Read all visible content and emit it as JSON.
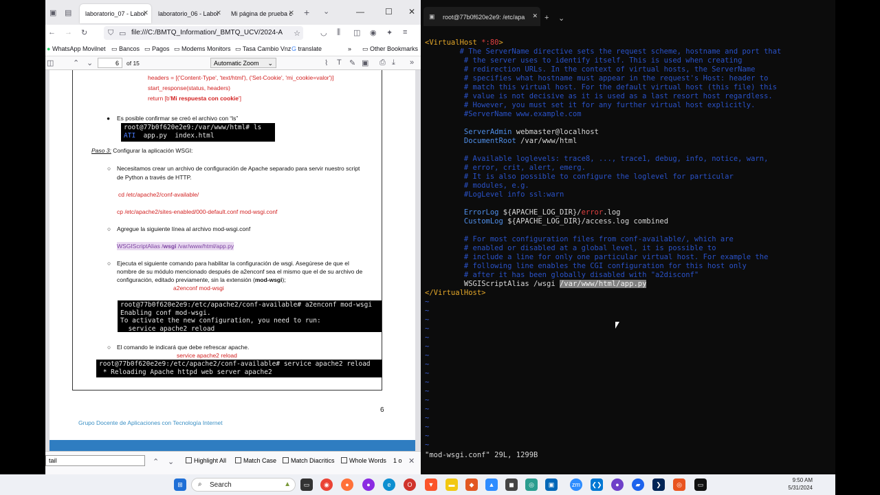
{
  "firefox": {
    "tabs": [
      "laboratorio_07 - Labor",
      "laboratorio_06 - Labor",
      "Mi página de prueba c"
    ],
    "url": "file:///C:/BMTQ_Information/_BMTQ_UCV/2024-A",
    "bookmarks": [
      "WhatsApp Movilnet",
      "Bancos",
      "Pagos",
      "Modems Monitors",
      "Tasa Cambio Vnz",
      "translate",
      "Other Bookmarks"
    ],
    "page_number": "6",
    "page_total": "of 15",
    "zoom": "Automatic Zoom",
    "find": {
      "query": "tail",
      "options": [
        "Highlight All",
        "Match Case",
        "Match Diacritics",
        "Whole Words"
      ],
      "count": "1 o"
    }
  },
  "pdf": {
    "code1": "headers = [('Content-Type', 'text/html'), ('Set-Cookie', 'mi_cookie=valor')]",
    "code2": "start_response(status, headers)",
    "code3_pre": "return [b'",
    "code3_bold": "Mi respuesta con cookie",
    "code3_post": "']",
    "bullet1": "Es posible confirmar se creó el archivo con “ls”",
    "term1_l1": "root@77b0f620e2e9:/var/www/html# ls",
    "term1_l2_a": "ATI",
    "term1_l2_b": "  app.py  index.html",
    "paso_label": "Paso 3:",
    "paso_text": "Configurar la aplicación WSGI:",
    "b2a": "Necesitamos crear un archivo de configuración de Apache separado para servir nuestro script",
    "b2b": "de Python a través de HTTP.",
    "cmd1": "cd /etc/apache2/conf-available/",
    "cmd2": "cp /etc/apache2/sites-enabled/000-default.conf mod-wsgi.conf",
    "b3": "Agregue la siguiente línea al archivo mod-wsgi.conf",
    "wsgi_a": "WSGIScriptAlias /",
    "wsgi_b": "wsgi",
    "wsgi_c": " /var/www/html/app.py",
    "b4a": "Ejecuta el siguiente comando para habilitar la configuración de wsgi. Asegúrese de que el",
    "b4b": "nombre de su módulo mencionado después de a2enconf sea el mismo que el de su archivo de",
    "b4c_pre": "configuración, editado previamente, sin la extensión (",
    "b4c_bold": "mod-wsgi",
    "b4c_post": ");",
    "cmd3": "a2enconf mod-wsgi",
    "term2": "root@77b0f620e2e9:/etc/apache2/conf-available# a2enconf mod-wsgi\nEnabling conf mod-wsgi.\nTo activate the new configuration, you need to run:\n  service apache2 reload",
    "b5": "El comando le indicará que debe refrescar apache.",
    "cmd4": "service apache2 reload",
    "term3": "root@77b0f620e2e9:/etc/apache2/conf-available# service apache2 reload\n * Reloading Apache httpd web server apache2",
    "page_num": "6",
    "footer": "Grupo Docente de Aplicaciones con Tecnología Internet"
  },
  "terminal": {
    "tab_title": "root@77b0f620e2e9: /etc/apa",
    "vh_open_a": "<VirtualHost",
    "vh_open_b": " *:80",
    "vh_open_c": ">",
    "c1": [
      "        # The ServerName directive sets the request scheme, hostname and port that",
      "         # the server uses to identify itself. This is used when creating",
      "         # redirection URLs. In the context of virtual hosts, the ServerName",
      "         # specifies what hostname must appear in the request's Host: header to",
      "         # match this virtual host. For the default virtual host (this file) this",
      "         # value is not decisive as it is used as a last resort host regardless.",
      "         # However, you must set it for any further virtual host explicitly.",
      "         #ServerName www.example.com"
    ],
    "sa_key": "ServerAdmin",
    "sa_val": " webmaster@localhost",
    "dr_key": "DocumentRoot",
    "dr_val": " /var/www/html",
    "c2": [
      "         # Available loglevels: trace8, ..., trace1, debug, info, notice, warn,",
      "         # error, crit, alert, emerg.",
      "         # It is also possible to configure the loglevel for particular",
      "         # modules, e.g.",
      "         #LogLevel info ssl:warn"
    ],
    "el_key": "ErrorLog",
    "el_a": " ${APACHE_LOG_DIR}/",
    "el_b": "error",
    "el_c": ".log",
    "cl_key": "CustomLog",
    "cl_val": " ${APACHE_LOG_DIR}/access.log combined",
    "c3": [
      "         # For most configuration files from conf-available/, which are",
      "         # enabled or disabled at a global level, it is possible to",
      "         # include a line for only one particular virtual host. For example the",
      "         # following line enables the CGI configuration for this host only",
      "         # after it has been globally disabled with \"a2disconf\""
    ],
    "ws_key": "WSGIScriptAlias /wsgi ",
    "ws_val": "/var/www/html/app.py",
    "vh_close": "</VirtualHost>",
    "tilde": "~",
    "status": "\"mod-wsgi.conf\" 29L, 1299B"
  },
  "taskbar": {
    "search": "Search",
    "time": "9:50 AM",
    "date": "5/31/2024"
  }
}
